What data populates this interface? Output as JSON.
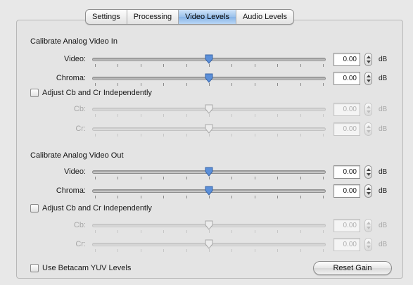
{
  "tabs": [
    {
      "label": "Settings",
      "selected": false
    },
    {
      "label": "Processing",
      "selected": false
    },
    {
      "label": "Video Levels",
      "selected": true
    },
    {
      "label": "Audio Levels",
      "selected": false
    }
  ],
  "analog_in": {
    "title": "Calibrate Analog Video In",
    "video": {
      "label": "Video:",
      "value": "0.00",
      "unit": "dB",
      "slider_fraction": 0.5
    },
    "chroma": {
      "label": "Chroma:",
      "value": "0.00",
      "unit": "dB",
      "slider_fraction": 0.5
    },
    "independent_checkbox": {
      "label": "Adjust Cb and Cr Independently",
      "checked": false
    },
    "cb": {
      "label": "Cb:",
      "value": "0.00",
      "unit": "dB",
      "slider_fraction": 0.5
    },
    "cr": {
      "label": "Cr:",
      "value": "0.00",
      "unit": "dB",
      "slider_fraction": 0.5
    }
  },
  "analog_out": {
    "title": "Calibrate Analog Video Out",
    "video": {
      "label": "Video:",
      "value": "0.00",
      "unit": "dB",
      "slider_fraction": 0.5
    },
    "chroma": {
      "label": "Chroma:",
      "value": "0.00",
      "unit": "dB",
      "slider_fraction": 0.5
    },
    "independent_checkbox": {
      "label": "Adjust Cb and Cr Independently",
      "checked": false
    },
    "cb": {
      "label": "Cb:",
      "value": "0.00",
      "unit": "dB",
      "slider_fraction": 0.5
    },
    "cr": {
      "label": "Cr:",
      "value": "0.00",
      "unit": "dB",
      "slider_fraction": 0.5
    }
  },
  "betacam_checkbox": {
    "label": "Use Betacam YUV Levels",
    "checked": false
  },
  "reset_button": {
    "label": "Reset Gain"
  },
  "colors": {
    "accent": "#5b8fd9",
    "disabled_text": "#a6a6a6"
  }
}
